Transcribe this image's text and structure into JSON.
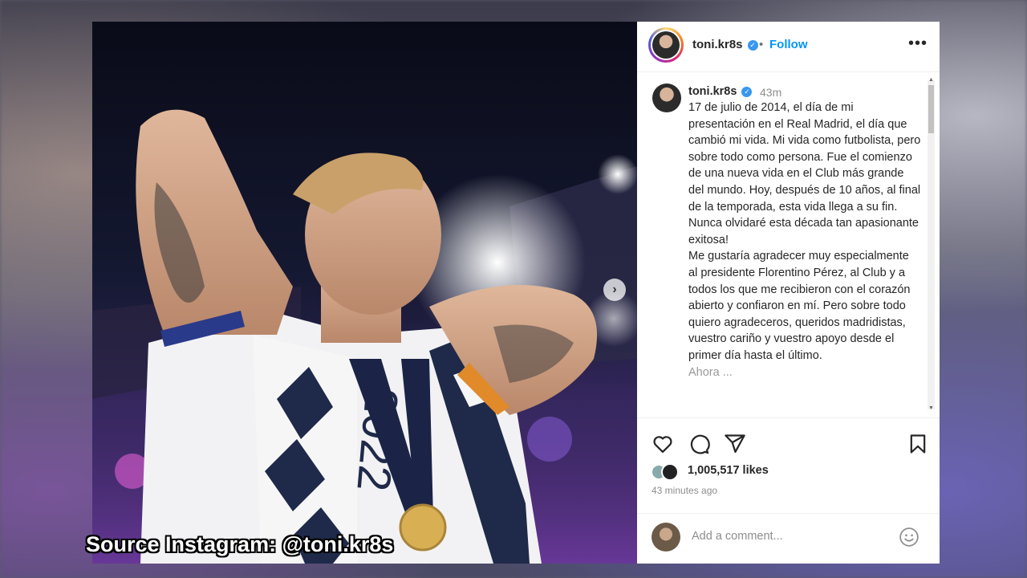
{
  "post": {
    "username": "toni.kr8s",
    "follow_label": "Follow",
    "separator": "•",
    "more_label": "•••",
    "photo_alt_text": "2022",
    "caption": {
      "username": "toni.kr8s",
      "time": "43m",
      "lines": [
        "17 de julio de 2014, el día de mi presentación en el Real Madrid, el día que cambió mi vida. Mi vida como futbolista, pero sobre todo como persona. Fue el comienzo de una nueva vida en el Club más grande del mundo. Hoy, después de 10 años, al final de la temporada, esta vida llega a su fin. Nunca olvidaré esta década tan apasionante exitosa!",
        "Me gustaría agradecer muy especialmente al presidente Florentino Pérez, al Club y a todos los que me recibieron con el corazón abierto y confiaron en mí. Pero sobre todo quiero agradeceros, queridos madridistas, vuestro cariño y vuestro apoyo desde el primer día hasta el último.",
        "Ahora ..."
      ]
    },
    "likes": "1,005,517 likes",
    "time_ago": "43 minutes ago",
    "comment_placeholder": "Add a comment..."
  },
  "overlay": {
    "source_label": "Source Instagram: @toni.kr8s"
  },
  "icons": {
    "like": "heart-icon",
    "comment": "comment-icon",
    "share": "share-icon",
    "save": "bookmark-icon",
    "emoji": "emoji-icon",
    "next": "chevron-right-icon"
  },
  "colors": {
    "follow": "#0095f6",
    "verified": "#3897f0",
    "text": "#262626",
    "muted": "#8e8e8e"
  }
}
